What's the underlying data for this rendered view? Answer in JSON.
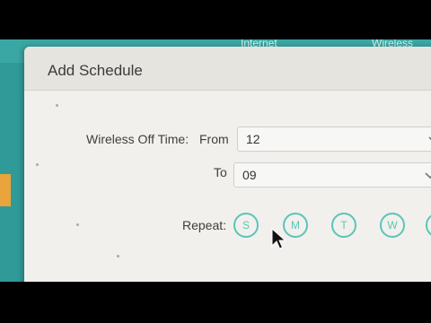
{
  "topnav": {
    "items": [
      {
        "label": "Internet"
      },
      {
        "label": "Wireless"
      }
    ]
  },
  "modal": {
    "title": "Add Schedule",
    "wireless_off_time_label": "Wireless Off Time:",
    "from_label": "From",
    "from_value": "12",
    "to_label": "To",
    "to_value": "09",
    "repeat_label": "Repeat:",
    "days": [
      {
        "label": "S"
      },
      {
        "label": "M"
      },
      {
        "label": "T"
      },
      {
        "label": "W"
      },
      {
        "label": ""
      }
    ]
  },
  "colors": {
    "teal_nav": "#3aa7a4",
    "day_circle": "#5cc4b8",
    "accent": "#e9a43c",
    "modal_bg": "#f1f0ed"
  },
  "icons": [
    "chevron-down-icon",
    "mouse-cursor-icon"
  ]
}
